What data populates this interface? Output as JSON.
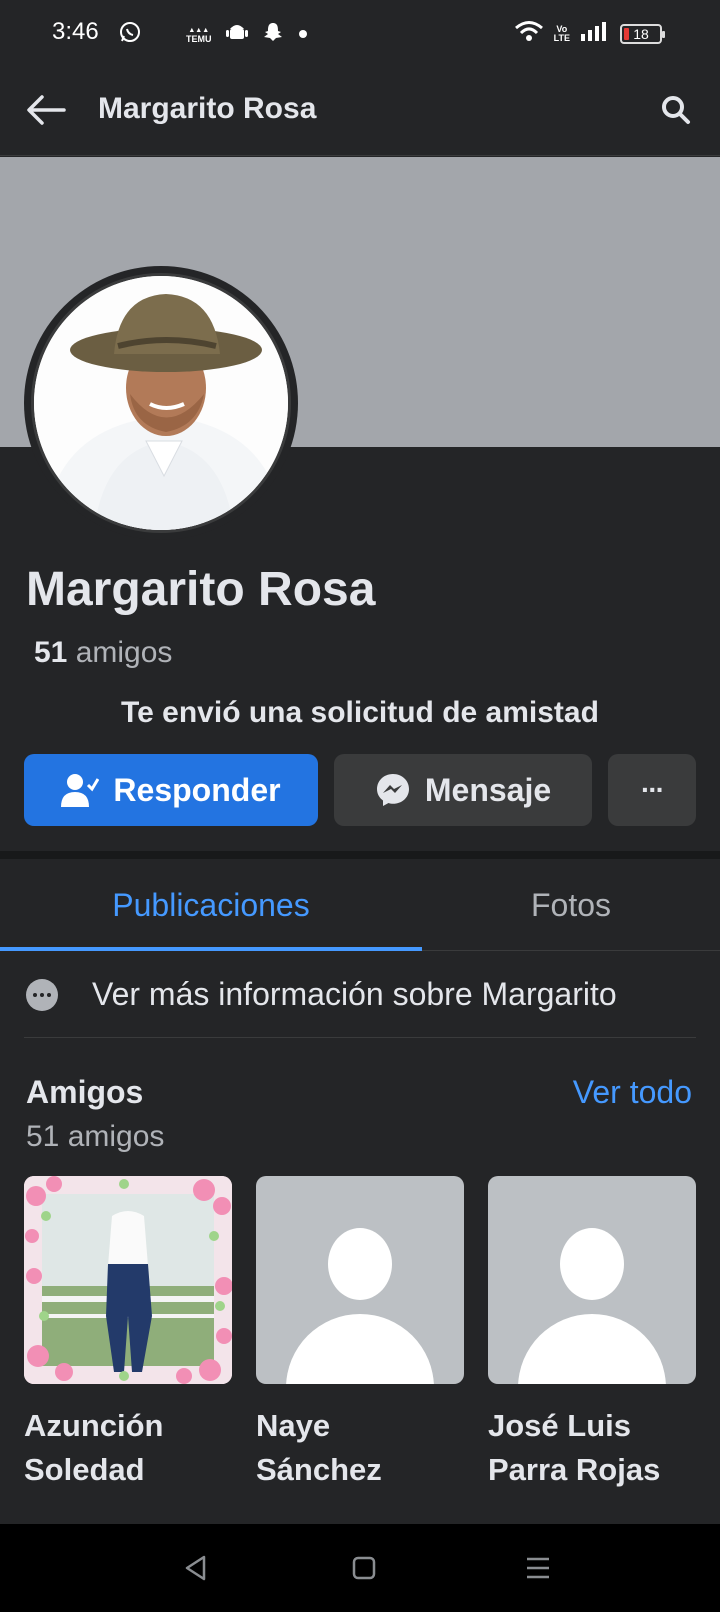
{
  "status_bar": {
    "time": "3:46",
    "left_icons": [
      "whatsapp-icon",
      "temu-icon",
      "android-icon",
      "snapchat-icon",
      "dot-icon"
    ],
    "temu_text": "TEMU",
    "network_label_top": "Vo",
    "network_label_bottom": "LTE",
    "battery_level": "18"
  },
  "appbar": {
    "title": "Margarito Rosa"
  },
  "profile": {
    "name": "Margarito Rosa",
    "friends_number": "51",
    "friends_word": "amigos",
    "request_text": "Te envió una solicitud de amistad"
  },
  "actions": {
    "respond_label": "Responder",
    "message_label": "Mensaje",
    "more_label": "···"
  },
  "tabs": [
    {
      "label": "Publicaciones",
      "active": true
    },
    {
      "label": "Fotos",
      "active": false
    }
  ],
  "info": {
    "text": "Ver más información sobre Margarito"
  },
  "friends_section": {
    "title": "Amigos",
    "see_all": "Ver todo",
    "subtitle": "51 amigos",
    "items": [
      {
        "name": "Azunción Soledad"
      },
      {
        "name": "Naye Sánchez"
      },
      {
        "name": "José Luis Parra Rojas"
      }
    ]
  },
  "colors": {
    "background": "#242527",
    "accent_blue": "#2374e1",
    "link_blue": "#4599ff",
    "cover_gray": "#a3a6ab",
    "secondary_button": "#3a3b3c"
  }
}
